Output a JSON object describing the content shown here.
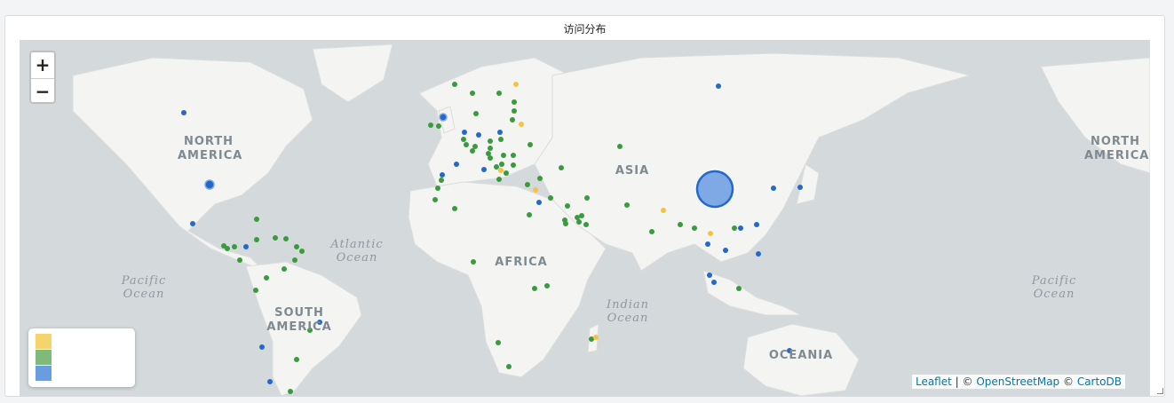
{
  "panel": {
    "title": "访问分布"
  },
  "map": {
    "zoom_in": "+",
    "zoom_out": "−",
    "continents": [
      {
        "name": "north-america",
        "text": "NORTH\nAMERICA",
        "lines": [
          "NORTH",
          "AMERICA"
        ]
      },
      {
        "name": "north-america-east",
        "lines": [
          "NORTH",
          "AMERICA"
        ]
      },
      {
        "name": "south-america",
        "lines": [
          "SOUTH",
          "AMERICA"
        ]
      },
      {
        "name": "asia",
        "lines": [
          "ASIA"
        ]
      },
      {
        "name": "africa",
        "lines": [
          "AFRICA"
        ]
      },
      {
        "name": "oceania",
        "lines": [
          "OCEANIA"
        ]
      }
    ],
    "oceans": [
      {
        "name": "atlantic",
        "lines": [
          "Atlantic",
          "Ocean"
        ]
      },
      {
        "name": "pacific-west",
        "lines": [
          "Pacific",
          "Ocean"
        ]
      },
      {
        "name": "indian",
        "lines": [
          "Indian",
          "Ocean"
        ]
      },
      {
        "name": "pacific-east",
        "lines": [
          "Pacific",
          "Ocean"
        ]
      }
    ],
    "colors": {
      "yellow": "#f5c342",
      "green": "#3a9a3e",
      "blue": "#2469c9",
      "big_fill": "#7fa9e4",
      "big_stroke": "#2469c9"
    },
    "attribution": {
      "leaflet": "Leaflet",
      "sep1": " | © ",
      "osm": "OpenStreetMap",
      "sep2": " © ",
      "carto": "CartoDB"
    }
  },
  "legend": {
    "items": [
      {
        "color": "#f5d56b",
        "label": ""
      },
      {
        "color": "#7fba7a",
        "label": ""
      },
      {
        "color": "#6a9de0",
        "label": ""
      }
    ]
  }
}
